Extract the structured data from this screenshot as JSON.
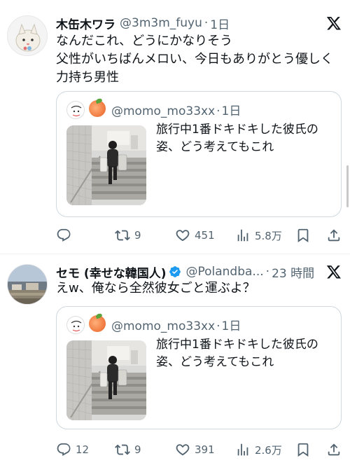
{
  "tweets": [
    {
      "name": "木缶木ワラ",
      "handle": "@3m3m_fuyu",
      "time": "1日",
      "text_lines": [
        "なんだこれ、どうにかなりそう",
        "父性がいちばんメロい、今日もありがとう優しく",
        "力持ち男性"
      ],
      "quote": {
        "handle": "@momo_mo33xx",
        "time": "1日",
        "text_lines": [
          "旅行中1番ドキドキした彼氏の",
          "姿、どう考えてもこれ"
        ]
      },
      "actions": {
        "replies": "",
        "retweets": "9",
        "likes": "451",
        "views": "5.8万"
      }
    },
    {
      "name": "セモ (幸せな韓国人)",
      "handle": "@Polandba...",
      "time": "23 時間",
      "text_lines": [
        "えw、俺なら全然彼女ごと運ぶよ？"
      ],
      "quote": {
        "handle": "@momo_mo33xx",
        "time": "1日",
        "text_lines": [
          "旅行中1番ドキドキした彼氏の",
          "姿、どう考えてもこれ"
        ]
      },
      "actions": {
        "replies": "12",
        "retweets": "9",
        "likes": "391",
        "views": "2.6万"
      }
    }
  ],
  "icons": {
    "reply": "reply-icon",
    "retweet": "retweet-icon",
    "like": "heart-icon",
    "views": "views-icon",
    "bookmark": "bookmark-icon",
    "share": "share-icon",
    "x_logo": "x-logo-icon",
    "verified": "verified-badge-icon"
  },
  "colors": {
    "text": "#0f1419",
    "secondary": "#536471",
    "border": "#cfd9de",
    "verified": "#1d9bf0"
  }
}
